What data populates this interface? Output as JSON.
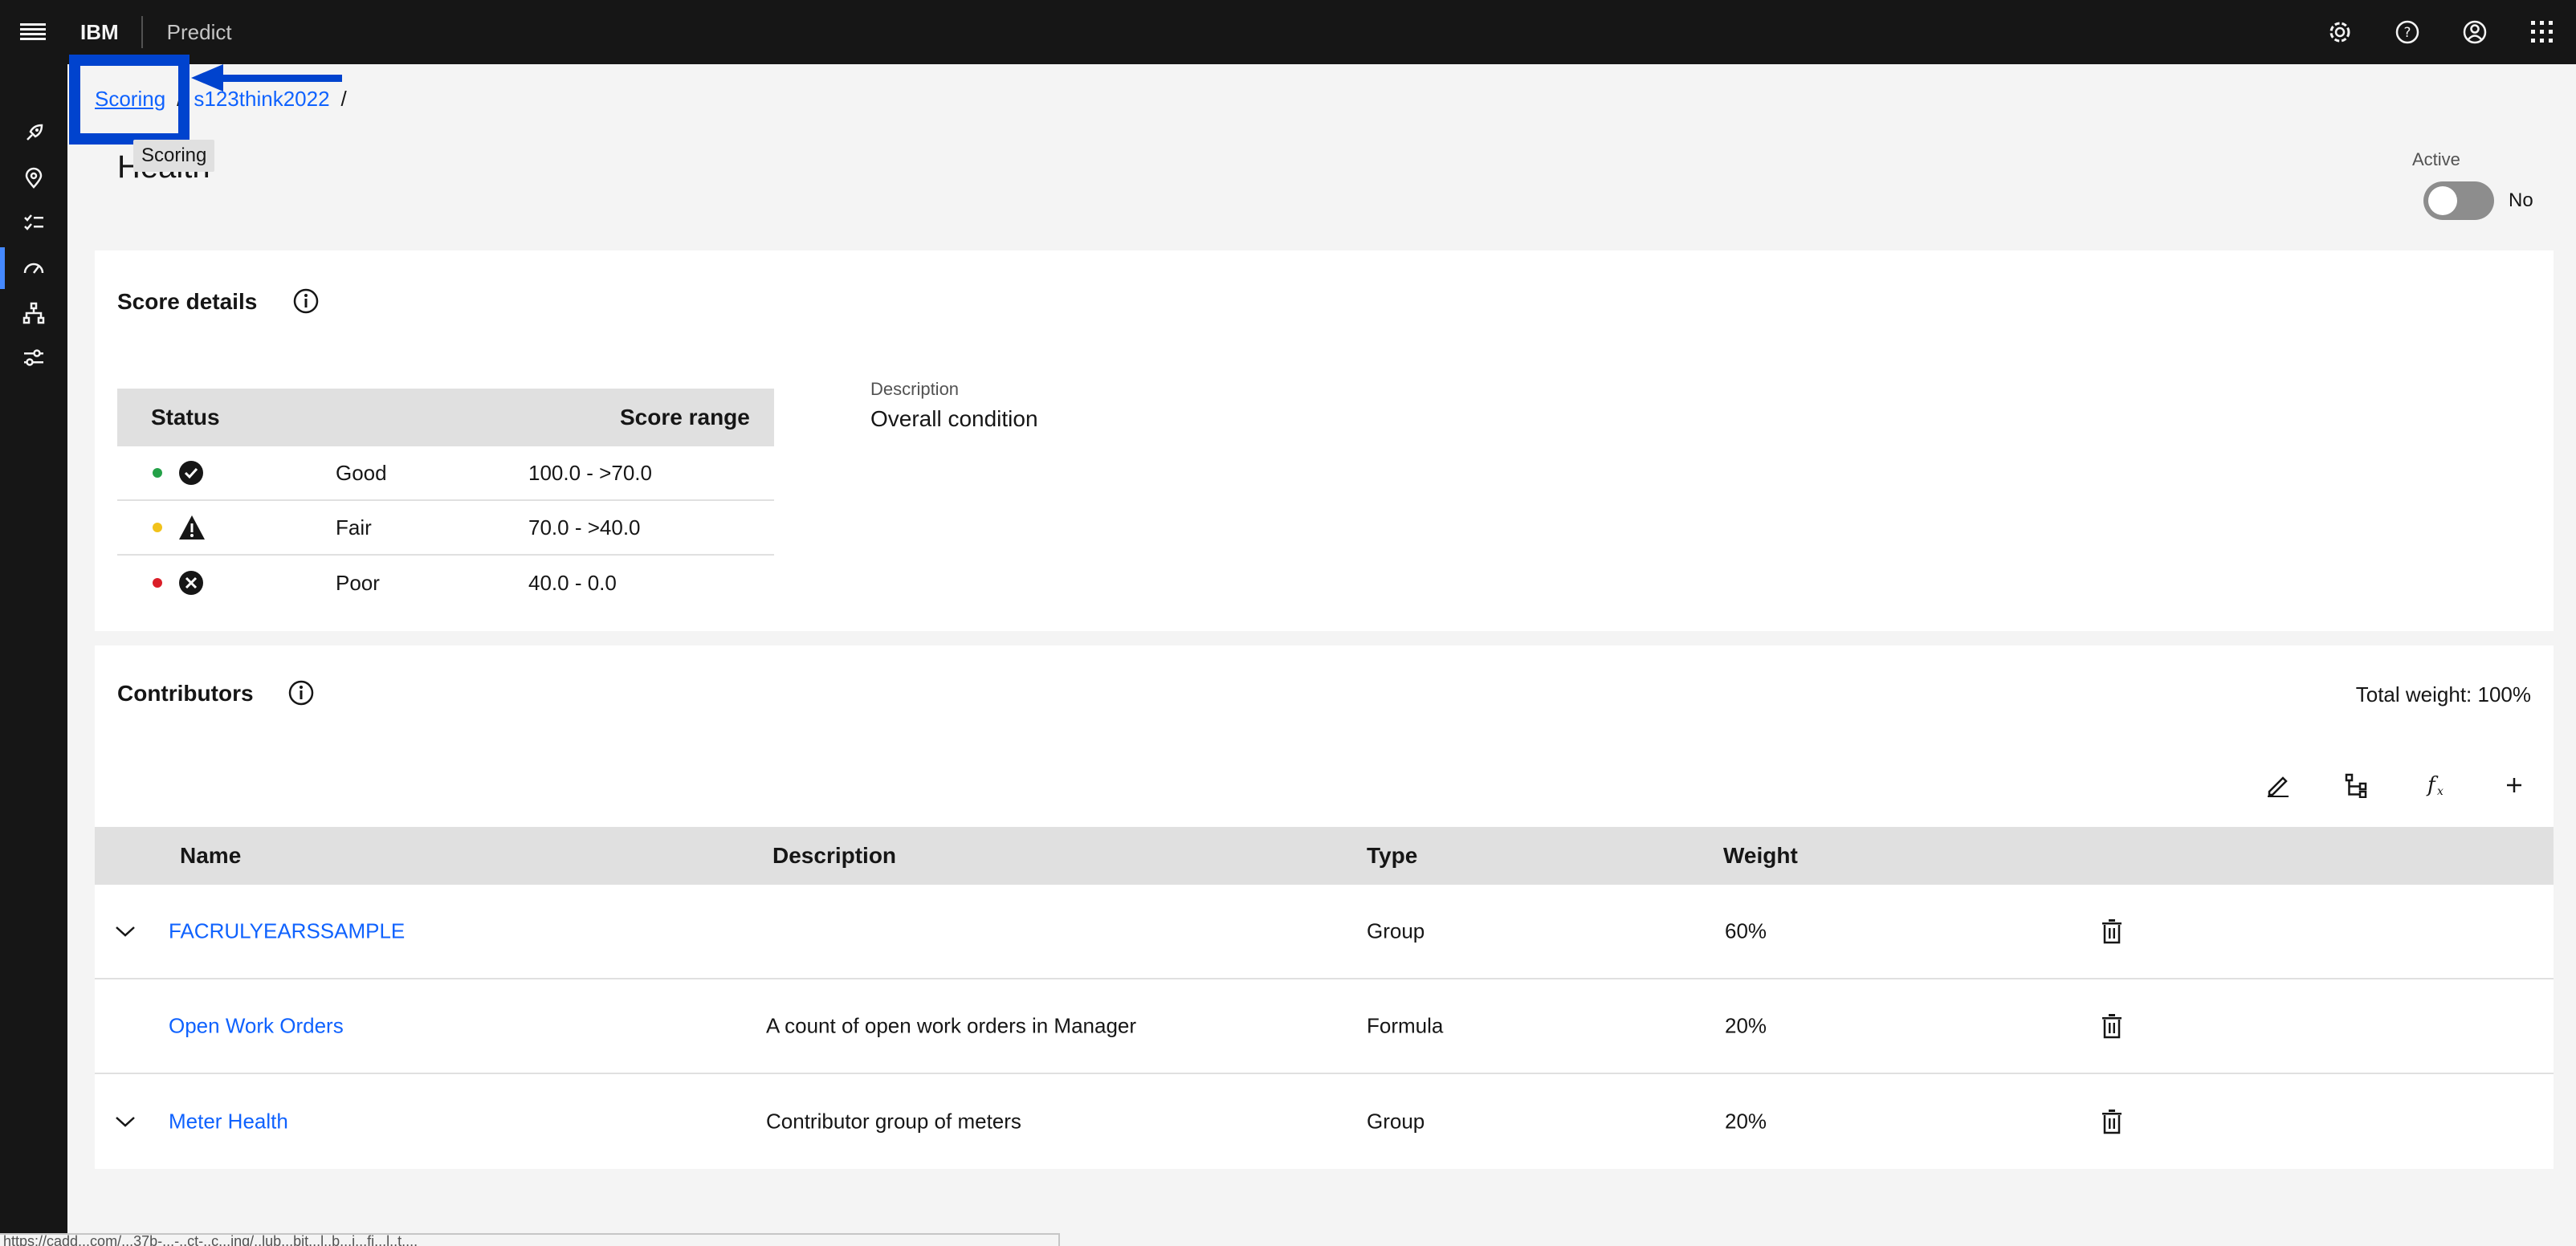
{
  "header": {
    "brand": "IBM",
    "product": "Predict"
  },
  "breadcrumb": {
    "items": [
      "Scoring",
      "s123think2022"
    ],
    "separator": "/"
  },
  "tooltip": "Scoring",
  "page": {
    "title": "Health"
  },
  "active": {
    "label": "Active",
    "value": "No"
  },
  "score_details": {
    "title": "Score details",
    "columns": [
      "Status",
      "Score range"
    ],
    "rows": [
      {
        "status": "Good",
        "range": "100.0 - >70.0",
        "color": "#24a148",
        "icon": "checkmark-filled-icon"
      },
      {
        "status": "Fair",
        "range": "70.0 - >40.0",
        "color": "#f1c21b",
        "icon": "warning-filled-icon"
      },
      {
        "status": "Poor",
        "range": "40.0 - 0.0",
        "color": "#da1e28",
        "icon": "error-filled-icon"
      }
    ],
    "description_label": "Description",
    "description_value": "Overall condition"
  },
  "contributors": {
    "title": "Contributors",
    "total_weight": "Total weight: 100%",
    "columns": [
      "Name",
      "Description",
      "Type",
      "Weight"
    ],
    "rows": [
      {
        "name": "FACRULYEARSSAMPLE",
        "description": "",
        "type": "Group",
        "weight": "60%",
        "expandable": true
      },
      {
        "name": "Open Work Orders",
        "description": "A count of open work orders in Manager",
        "type": "Formula",
        "weight": "20%",
        "expandable": false
      },
      {
        "name": "Meter Health",
        "description": "Contributor group of meters",
        "type": "Group",
        "weight": "20%",
        "expandable": true
      }
    ]
  },
  "statusbar": {
    "url": "https://cadd...com/...37b-...-..ct-..c...ing/..lub...bit...l..b...i...fi...l..t...."
  },
  "colors": {
    "accent": "#0f62fe",
    "highlight": "#0043ce"
  }
}
